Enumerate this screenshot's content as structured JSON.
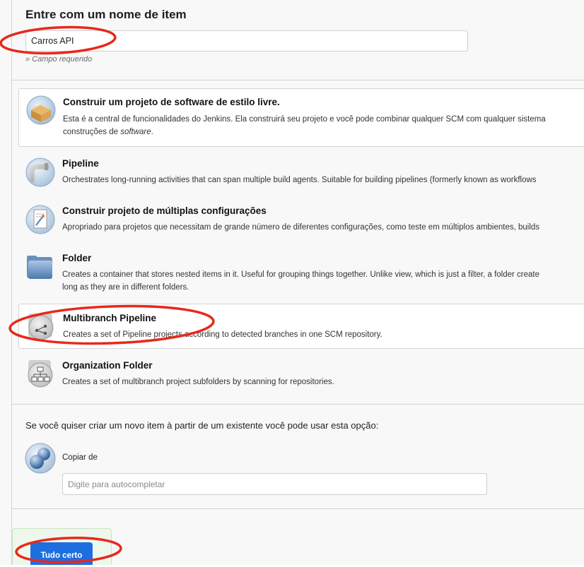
{
  "item_name": {
    "title": "Entre com um nome de item",
    "value": "Carros API",
    "required_note": "» Campo requerido"
  },
  "item_types": [
    {
      "title": "Construir um projeto de software de estilo livre.",
      "description_line1": "Esta é a central de funcionalidades do Jenkins. Ela construirá seu projeto e você pode combinar qualquer SCM com qualquer sistema",
      "description_line2_prefix": "construções de ",
      "description_line2_em": "software",
      "description_line2_suffix": ".",
      "icon": "freestyle-box-icon"
    },
    {
      "title": "Pipeline",
      "description_line1": "Orchestrates long-running activities that can span multiple build agents. Suitable for building pipelines (formerly known as workflows",
      "icon": "pipeline-pipe-icon"
    },
    {
      "title": "Construir projeto de múltiplas configurações",
      "description_line1": "Apropriado para projetos que necessitam de grande número de diferentes configurações, como teste em múltiplos ambientes, builds",
      "icon": "multi-config-icon"
    },
    {
      "title": "Folder",
      "description_line1": "Creates a container that stores nested items in it. Useful for grouping things together. Unlike view, which is just a filter, a folder create",
      "description_line2": "long as they are in different folders.",
      "icon": "folder-icon"
    },
    {
      "title": "Multibranch Pipeline",
      "description_line1": "Creates a set of Pipeline projects according to detected branches in one SCM repository.",
      "icon": "multibranch-pipeline-icon"
    },
    {
      "title": "Organization Folder",
      "description_line1": "Creates a set of multibranch project subfolders by scanning for repositories.",
      "icon": "organization-folder-icon"
    }
  ],
  "copy": {
    "intro": "Se você quiser criar um novo item à partir de um existente você pode usar esta opção:",
    "label": "Copiar de",
    "placeholder": "Digite para autocompletar",
    "icon": "copy-spheres-icon"
  },
  "footer": {
    "ok_label": "Tudo certo"
  },
  "colors": {
    "accent_button": "#1d6fe0",
    "annotation_red": "#e8281c"
  }
}
